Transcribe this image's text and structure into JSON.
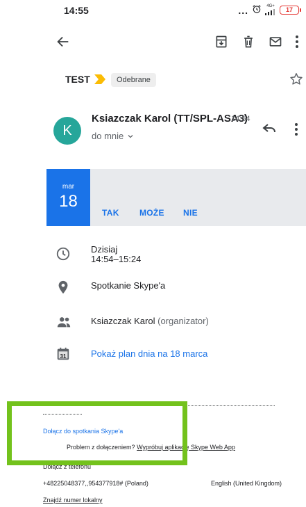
{
  "status_bar": {
    "time": "14:55",
    "dots": "...",
    "network": "4G+",
    "battery": "17"
  },
  "toolbar": {
    "back_icon": "arrow-left-icon",
    "archive_icon": "archive-icon",
    "delete_icon": "trash-icon",
    "unread_icon": "mail-icon",
    "more_icon": "more-vert-icon"
  },
  "subject": {
    "title": "TEST",
    "label": "Odebrane",
    "importance_color": "#fbbc04"
  },
  "sender": {
    "avatar_letter": "K",
    "avatar_color": "#26a69a",
    "name": "Ksiazczak Karol (TT/SPL-ASA3)",
    "time": "14:54",
    "recipient": "do mnie"
  },
  "event": {
    "month": "mar",
    "day": "18",
    "rsvp_yes": "TAK",
    "rsvp_maybe": "MOŻE",
    "rsvp_no": "NIE",
    "accent_color": "#1a73e8"
  },
  "details": {
    "date_line": "Dzisiaj",
    "time_line": "14:54–15:24",
    "location": "Spotkanie Skype'a",
    "organizer_name": "Ksiazczak Karol",
    "organizer_role": "(organizator)",
    "calendar_day": "31",
    "agenda_link": "Pokaż plan dnia na 18 marca"
  },
  "description": {
    "join_link": "Dołącz do spotkania Skype'a",
    "problem_text": "Problem z dołączeniem?",
    "problem_link": "Wypróbuj aplikację Skype Web App",
    "phone_join": "Dołącz z telefonu",
    "phone_number": "+48225048377,,954377918# (Poland)",
    "language": "English (United Kingdom)",
    "local_link": "Znajdź numer lokalny"
  }
}
